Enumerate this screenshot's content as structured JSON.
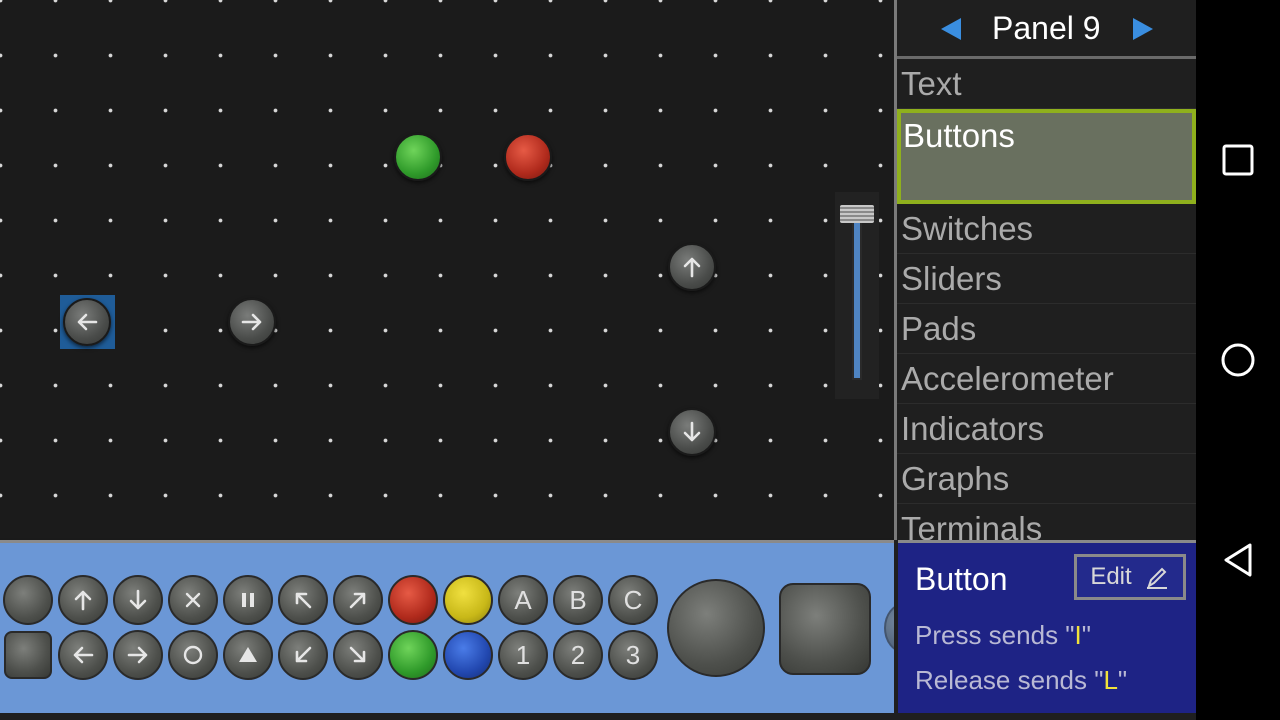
{
  "panel": {
    "title": "Panel 9"
  },
  "categories": [
    {
      "label": "Text",
      "selected": false
    },
    {
      "label": "Buttons",
      "selected": true
    },
    {
      "label": "Switches",
      "selected": false
    },
    {
      "label": "Sliders",
      "selected": false
    },
    {
      "label": "Pads",
      "selected": false
    },
    {
      "label": "Accelerometer",
      "selected": false
    },
    {
      "label": "Indicators",
      "selected": false
    },
    {
      "label": "Graphs",
      "selected": false
    },
    {
      "label": "Terminals",
      "selected": false
    }
  ],
  "properties": {
    "title": "Button",
    "edit_label": "Edit",
    "press_prefix": "Press sends \"",
    "press_value": "I",
    "release_prefix": "Release sends \"",
    "release_value": "L",
    "quote": "\""
  },
  "palette": {
    "row1_labels": {
      "a": "A",
      "b": "B",
      "c": "C"
    },
    "row2_labels": {
      "one": "1",
      "two": "2",
      "three": "3"
    }
  },
  "colors": {
    "accent_green": "#8fb01d",
    "palette_bg": "#6b97d6",
    "properties_bg": "#1e2385",
    "highlight_yellow": "#f2e23a"
  }
}
